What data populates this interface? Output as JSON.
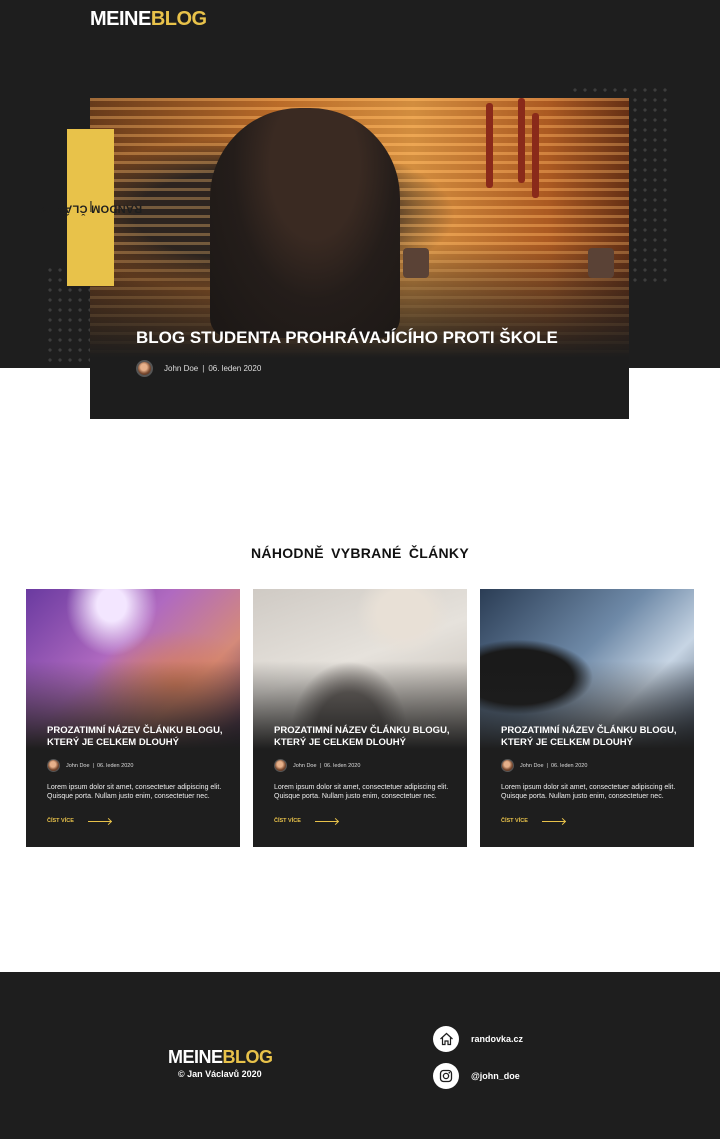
{
  "header": {
    "logo_part1": "MEINE",
    "logo_part2": "BLOG"
  },
  "hero": {
    "tag": "RANDOM ČLÁNEK",
    "title": "BLOG STUDENTA PROHRÁVAJÍCÍHO PROTI ŠKOLE",
    "author": "John Doe",
    "date": "06. leden 2020"
  },
  "section": {
    "title": "NÁHODNĚ VYBRANÉ ČLÁNKY"
  },
  "cards": [
    {
      "title": "PROZATIMNÍ NÁZEV ČLÁNKU BLOGU, KTERÝ JE CELKEM DLOUHÝ",
      "author": "John Doe",
      "date": "06. leden 2020",
      "text": "Lorem ipsum dolor sit amet, consectetuer adipiscing elit. Quisque porta.  Nullam justo enim, consectetuer nec.",
      "more": "ČÍST VÍCE"
    },
    {
      "title": "PROZATIMNÍ NÁZEV ČLÁNKU BLOGU, KTERÝ JE CELKEM DLOUHÝ",
      "author": "John Doe",
      "date": "06. leden 2020",
      "text": "Lorem ipsum dolor sit amet, consectetuer adipiscing elit. Quisque porta.  Nullam justo enim, consectetuer nec.",
      "more": "ČÍST VÍCE"
    },
    {
      "title": "PROZATIMNÍ NÁZEV ČLÁNKU BLOGU, KTERÝ JE CELKEM DLOUHÝ",
      "author": "John Doe",
      "date": "06. leden 2020",
      "text": "Lorem ipsum dolor sit amet, consectetuer adipiscing elit. Quisque porta.  Nullam justo enim, consectetuer nec.",
      "more": "ČÍST VÍCE"
    }
  ],
  "footer": {
    "logo_part1": "MEINE",
    "logo_part2": "BLOG",
    "copyright": "© Jan Václavů 2020",
    "links": [
      {
        "icon": "home-icon",
        "label": "randovka.cz"
      },
      {
        "icon": "instagram-icon",
        "label": "@john_doe"
      }
    ]
  },
  "colors": {
    "accent": "#e8c24a",
    "dark": "#1e1e1e"
  }
}
